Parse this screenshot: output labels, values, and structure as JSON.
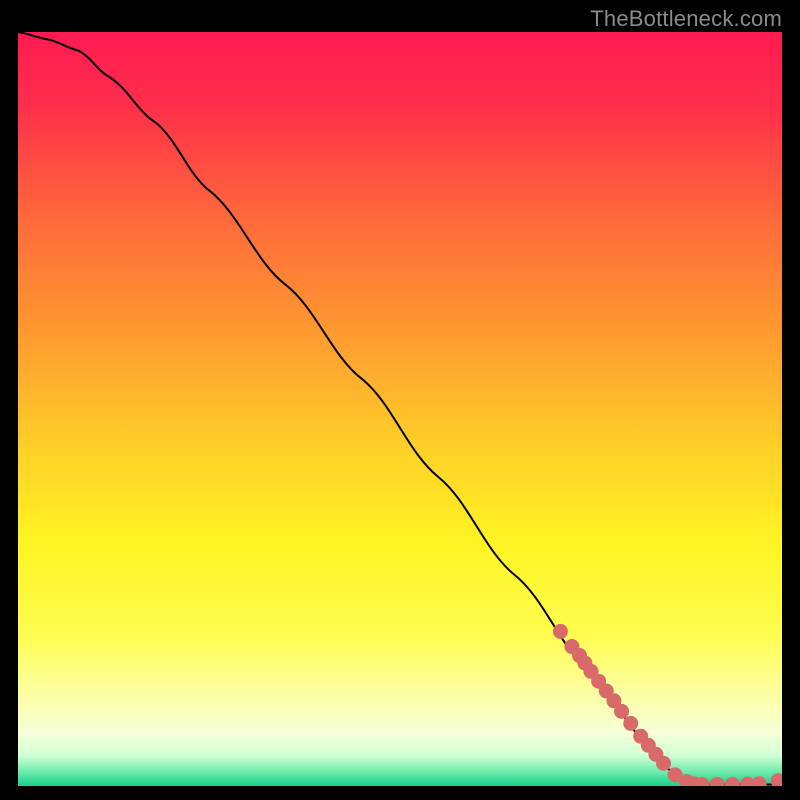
{
  "watermark": "TheBottleneck.com",
  "chart_data": {
    "type": "line",
    "title": "",
    "xlabel": "",
    "ylabel": "",
    "xlim": [
      0,
      100
    ],
    "ylim": [
      0,
      100
    ],
    "curve": [
      {
        "x": 0,
        "y": 100
      },
      {
        "x": 4,
        "y": 99
      },
      {
        "x": 8,
        "y": 97.5
      },
      {
        "x": 12,
        "y": 94
      },
      {
        "x": 18,
        "y": 88
      },
      {
        "x": 25,
        "y": 79
      },
      {
        "x": 35,
        "y": 66.5
      },
      {
        "x": 45,
        "y": 54
      },
      {
        "x": 55,
        "y": 41
      },
      {
        "x": 65,
        "y": 28
      },
      {
        "x": 75,
        "y": 15
      },
      {
        "x": 82,
        "y": 6
      },
      {
        "x": 86,
        "y": 1.5
      },
      {
        "x": 89,
        "y": 0.2
      },
      {
        "x": 100,
        "y": 0.2
      }
    ],
    "markers": [
      {
        "x": 71,
        "y": 20.5
      },
      {
        "x": 72.5,
        "y": 18.5
      },
      {
        "x": 73.5,
        "y": 17.3
      },
      {
        "x": 74.2,
        "y": 16.3
      },
      {
        "x": 75,
        "y": 15.2
      },
      {
        "x": 76,
        "y": 13.9
      },
      {
        "x": 77,
        "y": 12.6
      },
      {
        "x": 78,
        "y": 11.3
      },
      {
        "x": 79,
        "y": 9.9
      },
      {
        "x": 80.2,
        "y": 8.3
      },
      {
        "x": 81.5,
        "y": 6.6
      },
      {
        "x": 82.5,
        "y": 5.4
      },
      {
        "x": 83.5,
        "y": 4.2
      },
      {
        "x": 84.5,
        "y": 3.0
      },
      {
        "x": 86,
        "y": 1.5
      },
      {
        "x": 87.5,
        "y": 0.6
      },
      {
        "x": 88.5,
        "y": 0.3
      },
      {
        "x": 89.5,
        "y": 0.2
      },
      {
        "x": 91.5,
        "y": 0.2
      },
      {
        "x": 93.5,
        "y": 0.2
      },
      {
        "x": 95.5,
        "y": 0.25
      },
      {
        "x": 97,
        "y": 0.3
      },
      {
        "x": 99.5,
        "y": 0.7
      }
    ],
    "gradient_stops": [
      {
        "offset": 0.0,
        "color": "#ff1a52"
      },
      {
        "offset": 0.1,
        "color": "#ff2f4a"
      },
      {
        "offset": 0.25,
        "color": "#ff6a3b"
      },
      {
        "offset": 0.4,
        "color": "#ff9a30"
      },
      {
        "offset": 0.55,
        "color": "#ffcf28"
      },
      {
        "offset": 0.68,
        "color": "#fff423"
      },
      {
        "offset": 0.8,
        "color": "#fffd50"
      },
      {
        "offset": 0.88,
        "color": "#fbffa5"
      },
      {
        "offset": 0.93,
        "color": "#f6ffd9"
      },
      {
        "offset": 0.96,
        "color": "#cfffd4"
      },
      {
        "offset": 0.982,
        "color": "#6be9ab"
      },
      {
        "offset": 1.0,
        "color": "#18d18c"
      }
    ],
    "marker_color": "#d86a6a",
    "line_color": "#000000"
  }
}
